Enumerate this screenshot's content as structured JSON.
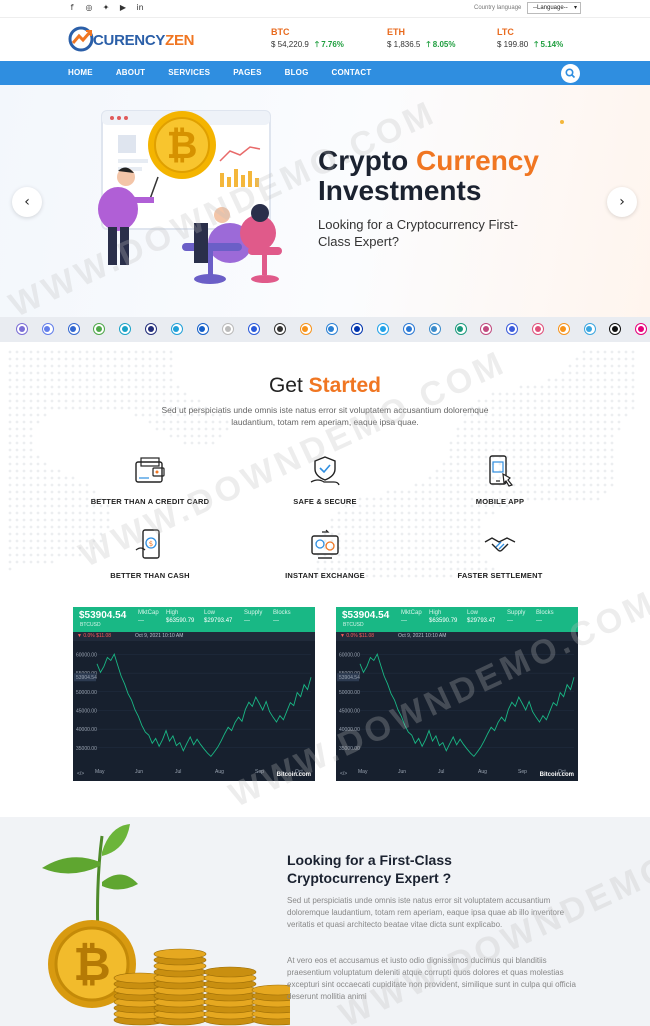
{
  "topbar": {
    "social_icons": [
      "facebook-icon",
      "instagram-icon",
      "twitter-icon",
      "youtube-icon",
      "linkedin-icon"
    ],
    "language_label": "Country language",
    "language_value": "--Language--"
  },
  "header": {
    "logo_text_a": "CURENCY",
    "logo_text_b": "ZEN",
    "tickers": [
      {
        "symbol": "BTC",
        "price": "$ 54,220.9",
        "change": "7.76%"
      },
      {
        "symbol": "ETH",
        "price": "$ 1,836.5",
        "change": "8.05%"
      },
      {
        "symbol": "LTC",
        "price": "$ 199.80",
        "change": "5.14%"
      }
    ]
  },
  "nav": {
    "items": [
      "HOME",
      "ABOUT",
      "SERVICES",
      "PAGES",
      "BLOG",
      "CONTACT"
    ]
  },
  "hero": {
    "title_a": "Crypto ",
    "title_b": "Currency",
    "title_c": "Investments",
    "subtitle": "Looking for a Cryptocurrency First-Class Expert?",
    "prev_icon": "chevron-left-icon",
    "next_icon": "chevron-right-icon"
  },
  "colors": {
    "brand_blue": "#2f8ee0",
    "brand_orange": "#f07622",
    "positive_green": "#1e9e3e",
    "widget_green": "#19b885",
    "widget_dark": "#17202e"
  },
  "coin_strip": {
    "coin_colors": [
      "#7b6ed6",
      "#627eea",
      "#3468d1",
      "#4fa84a",
      "#1aa2c7",
      "#232e7a",
      "#21a0d8",
      "#1560c9",
      "#bbbbbb",
      "#2a5ada",
      "#333333",
      "#f7931a",
      "#2a80d4",
      "#0033ad",
      "#23a2e8",
      "#2a78d4",
      "#3c8ccc",
      "#1a9a7c",
      "#c14a7f",
      "#3b5bdb",
      "#e0507a",
      "#f7931a",
      "#3aa6e0",
      "#111111",
      "#e6007a"
    ]
  },
  "get_started": {
    "title_a": "Get ",
    "title_b": "Started",
    "description": "Sed ut perspiciatis unde omnis iste natus error sit voluptatem accusantium doloremque laudantium, totam rem aperiam, eaque ipsa quae.",
    "features": [
      {
        "label": "BETTER THAN A CREDIT CARD",
        "icon": "wallet-card-icon"
      },
      {
        "label": "SAFE & SECURE",
        "icon": "shield-hand-icon"
      },
      {
        "label": "MOBILE APP",
        "icon": "mobile-touch-icon"
      },
      {
        "label": "BETTER THAN CASH",
        "icon": "phone-cash-icon"
      },
      {
        "label": "INSTANT EXCHANGE",
        "icon": "exchange-icon"
      },
      {
        "label": "FASTER SETTLEMENT",
        "icon": "handshake-icon"
      }
    ]
  },
  "widgets": [
    {
      "price": "$53904.54",
      "code": "BTCUSD",
      "stats": [
        {
          "label": "MktCap",
          "value": "---"
        },
        {
          "label": "High",
          "value": "$63590.79"
        },
        {
          "label": "Low",
          "value": "$29793.47"
        },
        {
          "label": "Supply",
          "value": "---"
        },
        {
          "label": "Blocks",
          "value": "---"
        }
      ],
      "change": "▼ 0.0% $11.08",
      "date": "Oct 9, 2021 10:10 AM",
      "y_ticks": [
        "60000.00",
        "55000.00",
        "50000.00",
        "45000.00",
        "40000.00",
        "35000.00"
      ],
      "x_ticks": [
        "May",
        "Jun",
        "Jul",
        "Aug",
        "Sep",
        "Oct"
      ],
      "current_label": "53904.54",
      "brand": "Bitcoin.com",
      "embed_icon": "code-icon"
    },
    {
      "price": "$53904.54",
      "code": "BTCUSD",
      "stats": [
        {
          "label": "MktCap",
          "value": "---"
        },
        {
          "label": "High",
          "value": "$63590.79"
        },
        {
          "label": "Low",
          "value": "$29793.47"
        },
        {
          "label": "Supply",
          "value": "---"
        },
        {
          "label": "Blocks",
          "value": "---"
        }
      ],
      "change": "▼ 0.0% $11.08",
      "date": "Oct 9, 2021 10:10 AM",
      "y_ticks": [
        "60000.00",
        "55000.00",
        "50000.00",
        "45000.00",
        "40000.00",
        "35000.00"
      ],
      "x_ticks": [
        "May",
        "Jun",
        "Jul",
        "Aug",
        "Sep",
        "Oct"
      ],
      "current_label": "53904.54",
      "brand": "Bitcoin.com",
      "embed_icon": "code-icon"
    }
  ],
  "price_series": [
    57500,
    55200,
    56800,
    59200,
    58400,
    60100,
    57100,
    54200,
    52100,
    49500,
    47800,
    45200,
    43400,
    41000,
    39200,
    38400,
    36200,
    37500,
    35400,
    37200,
    39600,
    36800,
    38200,
    35600,
    36400,
    34200,
    36100,
    37900,
    35800,
    37300,
    35900,
    34700,
    33600,
    32700,
    33900,
    35200,
    36900,
    38800,
    40500,
    39600,
    41800,
    43200,
    42100,
    45300,
    47200,
    46100,
    48600,
    46900,
    45100,
    47400,
    44700,
    43200,
    41900,
    43600,
    42500,
    44800,
    47100,
    46300,
    49800,
    48700,
    51900,
    50600,
    53904
  ],
  "about": {
    "title": "Looking for a First-Class Cryptocurrency Expert ?",
    "para1": "Sed ut perspiciatis unde omnis iste natus error sit voluptatem accusantium doloremque laudantium, totam rem aperiam, eaque ipsa quae ab illo inventore veritatis et quasi architecto beatae vitae dicta sunt explicabo.",
    "para2": "At vero eos et accusamus et iusto odio dignissimos ducimus qui blanditiis praesentium voluptatum deleniti atque corrupti quos dolores et quas molestias excepturi sint occaecati cupiditate non provident, similique sunt in culpa qui officia deserunt mollitia animi"
  },
  "watermark": {
    "text_a": "WWW.DOWNDEMO.COM",
    "text_b": "DOWNDEMO"
  }
}
